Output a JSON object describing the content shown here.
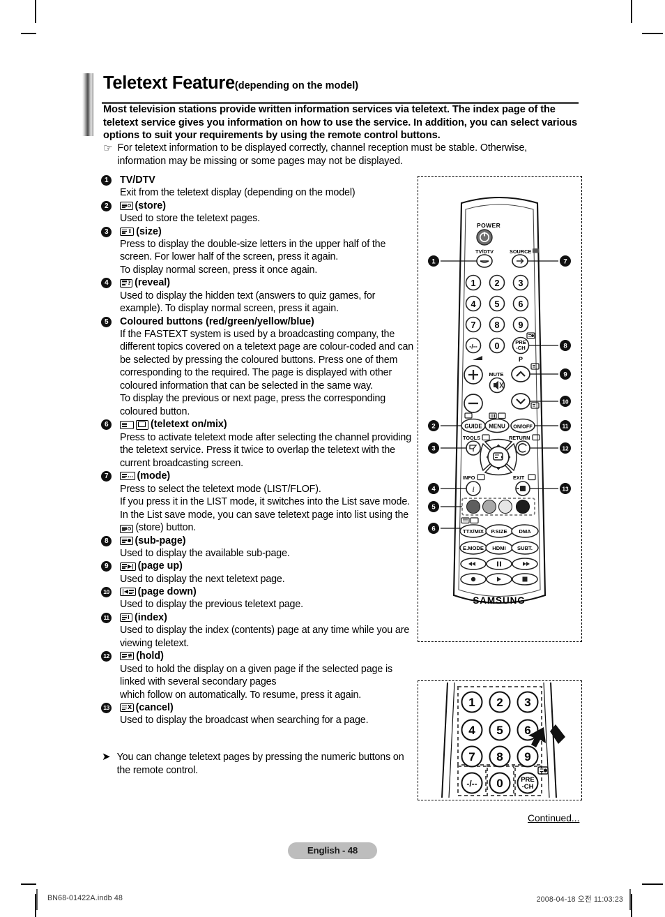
{
  "title": {
    "main": "Teletext Feature",
    "sub": "(depending on the model)"
  },
  "intro": {
    "paragraph": "Most television stations provide written information services via teletext. The index page of the teletext service gives you information on how to use the service. In addition, you can select various options to suit your requirements by using the remote control buttons.",
    "note_icon": "pointing-hand-icon",
    "note": "For teletext information to be displayed correctly, channel reception must be stable. Otherwise, information may be missing or some pages may not be displayed."
  },
  "items": [
    {
      "num": "1",
      "icon": "none",
      "label": "TV/DTV",
      "desc": "Exit from the teletext display (depending on the model)"
    },
    {
      "num": "2",
      "icon": "teletext-store-icon",
      "label": "(store)",
      "desc": "Used to store the teletext pages."
    },
    {
      "num": "3",
      "icon": "teletext-size-icon",
      "label": "(size)",
      "desc": "Press to display the double-size letters in the upper half of the screen. For lower half of the screen, press it again.\nTo display normal screen, press it once again."
    },
    {
      "num": "4",
      "icon": "teletext-reveal-icon",
      "label": "(reveal)",
      "desc": "Used to display the hidden text (answers to quiz games, for example). To display normal screen, press it again."
    },
    {
      "num": "5",
      "icon": "none",
      "label": "Coloured buttons (red/green/yellow/blue)",
      "desc": "If the FASTEXT system is used by a broadcasting company, the different topics covered on a teletext page are colour-coded and can be selected by pressing the coloured buttons. Press one of them corresponding to the required. The page is displayed with other coloured information that can be selected in the same way.\nTo display the previous or next page, press the corresponding coloured button."
    },
    {
      "num": "6",
      "icon": "teletext-on-mix-icon",
      "label": "(teletext on/mix)",
      "desc": "Press to activate teletext mode after selecting the channel providing the teletext service. Press it twice to overlap the teletext with the current broadcasting screen."
    },
    {
      "num": "7",
      "icon": "teletext-mode-icon",
      "label": "(mode)",
      "desc": "Press to select the teletext mode (LIST/FLOF).\nIf you press it in the LIST mode, it switches into the List save mode.\nIn the List save mode, you can save teletext page into list using the  (store) button."
    },
    {
      "num": "8",
      "icon": "teletext-subpage-icon",
      "label": "(sub-page)",
      "desc": "Used to display the available sub-page."
    },
    {
      "num": "9",
      "icon": "teletext-page-up-icon",
      "label": "(page up)",
      "desc": "Used to display the next teletext page."
    },
    {
      "num": "10",
      "icon": "teletext-page-down-icon",
      "label": "(page down)",
      "desc": "Used to display the previous teletext page."
    },
    {
      "num": "11",
      "icon": "teletext-index-icon",
      "label": "(index)",
      "desc": "Used to display the index (contents) page at any time while you are viewing teletext."
    },
    {
      "num": "12",
      "icon": "teletext-hold-icon",
      "label": "(hold)",
      "desc": "Used to hold the display on a given page if the selected page is linked with several secondary pages\nwhich follow on automatically. To resume, press it again."
    },
    {
      "num": "13",
      "icon": "teletext-cancel-icon",
      "label": "(cancel)",
      "desc": "Used to display the broadcast when searching for a page."
    }
  ],
  "arrow_note": {
    "icon": "arrow-bullet-icon",
    "text": "You can change teletext pages by pressing the numeric buttons on the remote control."
  },
  "remote": {
    "brand": "SAMSUNG",
    "power_label": "POWER",
    "tvdtv_label": "TV/DTV",
    "source_label": "SOURCE",
    "mute_label": "MUTE",
    "pre_ch_label": "PRE\n-CH",
    "p_label": "P",
    "guide_label": "GUIDE",
    "menu_label": "MENU",
    "onoff_label": "ON/OFF",
    "tools_label": "TOOLS",
    "return_label": "RETURN",
    "info_label": "INFO",
    "exit_label": "EXIT",
    "keypad": [
      "1",
      "2",
      "3",
      "4",
      "5",
      "6",
      "7",
      "8",
      "9"
    ],
    "keypad_extra": [
      "-/--",
      "0"
    ],
    "function_buttons": [
      "TTX/MIX",
      "P.SIZE",
      "DMA",
      "E.MODE",
      "HDMI",
      "SUBT."
    ],
    "transport_buttons": [
      "rewind",
      "pause",
      "fast-forward",
      "record",
      "play",
      "stop"
    ],
    "colour_buttons": [
      "red",
      "green",
      "yellow",
      "blue"
    ],
    "callouts_left": [
      "1",
      "2",
      "3",
      "4",
      "5",
      "6"
    ],
    "callouts_right": [
      "7",
      "8",
      "9",
      "10",
      "11",
      "12",
      "13"
    ]
  },
  "keypad_diagram": {
    "keys": [
      "1",
      "2",
      "3",
      "4",
      "5",
      "6",
      "7",
      "8",
      "9"
    ],
    "bottom_keys": [
      "-/--",
      "0"
    ],
    "pre_ch": "PRE\n-CH"
  },
  "continued": "Continued...",
  "page_badge": "English - 48",
  "footer": {
    "left": "BN68-01422A.indb   48",
    "right": "2008-04-18   오전 11:03:23"
  },
  "colors": {
    "rule": "#4f4f4f",
    "badge_bg": "#bdbdbd",
    "text": "#000000"
  }
}
